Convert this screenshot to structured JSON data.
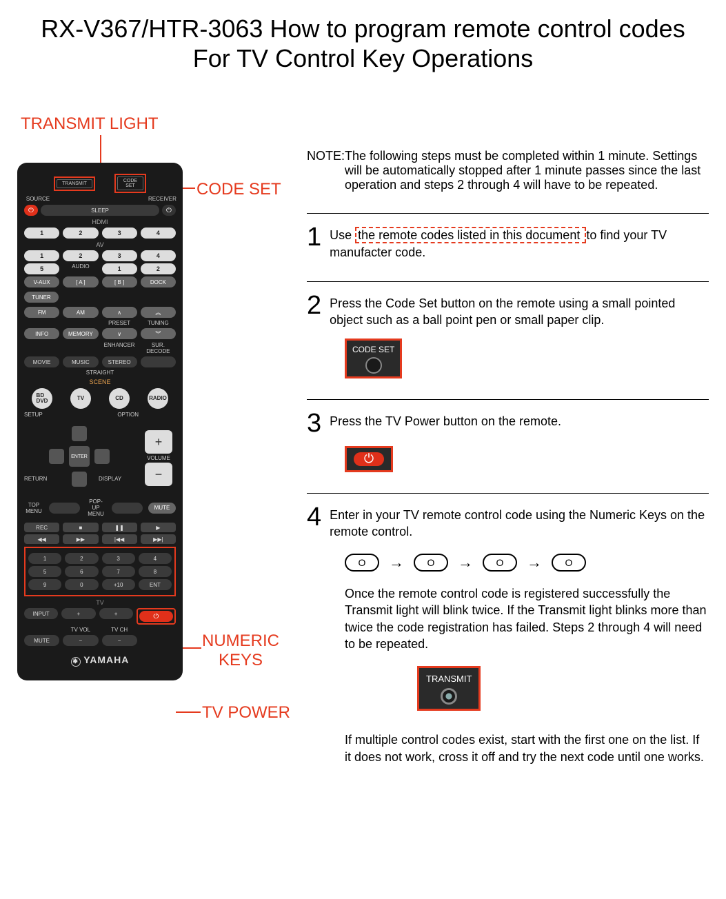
{
  "title_line1": "RX-V367/HTR-3063 How to program remote control codes",
  "title_line2": "For TV Control Key Operations",
  "callouts": {
    "transmit_light": "TRANSMIT LIGHT",
    "code_set": "CODE SET",
    "numeric_keys_l1": "NUMERIC",
    "numeric_keys_l2": "KEYS",
    "tv_power": "TV POWER"
  },
  "remote": {
    "transmit": "TRANSMIT",
    "code_set": "CODE SET",
    "source": "SOURCE",
    "receiver": "RECEIVER",
    "sleep": "SLEEP",
    "hdmi": "HDMI",
    "b1": "1",
    "b2": "2",
    "b3": "3",
    "b4": "4",
    "av": "AV",
    "a1": "1",
    "a2": "2",
    "a3": "3",
    "a4": "4",
    "a5": "5",
    "audio": "AUDIO",
    "au1": "1",
    "au2": "2",
    "vaux": "V-AUX",
    "kA": "[ A ]",
    "kB": "[ B ]",
    "dock": "DOCK",
    "tuner": "TUNER",
    "fm": "FM",
    "am": "AM",
    "info": "INFO",
    "memory": "MEMORY",
    "preset": "PRESET",
    "tuning": "TUNING",
    "enhancer": "ENHANCER",
    "surdecode": "SUR. DECODE",
    "movie": "MOVIE",
    "music": "MUSIC",
    "stereo": "STEREO",
    "straight": "STRAIGHT",
    "scene": "SCENE",
    "sc1": "BD\nDVD",
    "sc2": "TV",
    "sc3": "CD",
    "sc4": "RADIO",
    "setup": "SETUP",
    "option": "OPTION",
    "enter": "ENTER",
    "volume": "VOLUME",
    "return": "RETURN",
    "display": "DISPLAY",
    "topmenu": "TOP\nMENU",
    "popupmenu": "POP-UP\nMENU",
    "mute": "MUTE",
    "rec": "REC",
    "n1": "1",
    "n2": "2",
    "n3": "3",
    "n4": "4",
    "n5": "5",
    "n6": "6",
    "n7": "7",
    "n8": "8",
    "n9": "9",
    "n0": "0",
    "n10": "+10",
    "nent": "ENT",
    "tv": "TV",
    "input": "INPUT",
    "tvvol": "TV VOL",
    "tvch": "TV CH",
    "mute2": "MUTE",
    "brand": "YAMAHA"
  },
  "note_label": "NOTE:",
  "note_text": "The following steps must be completed within 1 minute. Settings will be automatically stopped after 1 minute passes since the last operation and steps 2 through 4 will have to be repeated.",
  "steps": {
    "s1n": "1",
    "s1a": "Use ",
    "s1b": "the remote codes listed in this document ",
    "s1c": "to find your TV manufacter code.",
    "s2n": "2",
    "s2": "Press the Code Set button on the remote using a small pointed object such as a ball point pen or small paper clip.",
    "s2_label": "CODE SET",
    "s3n": "3",
    "s3": "Press the TV Power button on the remote.",
    "s4n": "4",
    "s4": "Enter in your TV remote control code using the Numeric Keys on the remote control.",
    "seqO": "O",
    "arrow": "→",
    "s4_para": "Once the remote control code is registered successfully the Transmit light will blink twice.  If the Transmit light blinks more than twice the code registration has failed. Steps 2 through 4 will need to be repeated.",
    "transmit_label": "TRANSMIT",
    "final": "If multiple control codes exist, start with the first one on the list.  If it does not work, cross it off and try the next code until one works."
  }
}
